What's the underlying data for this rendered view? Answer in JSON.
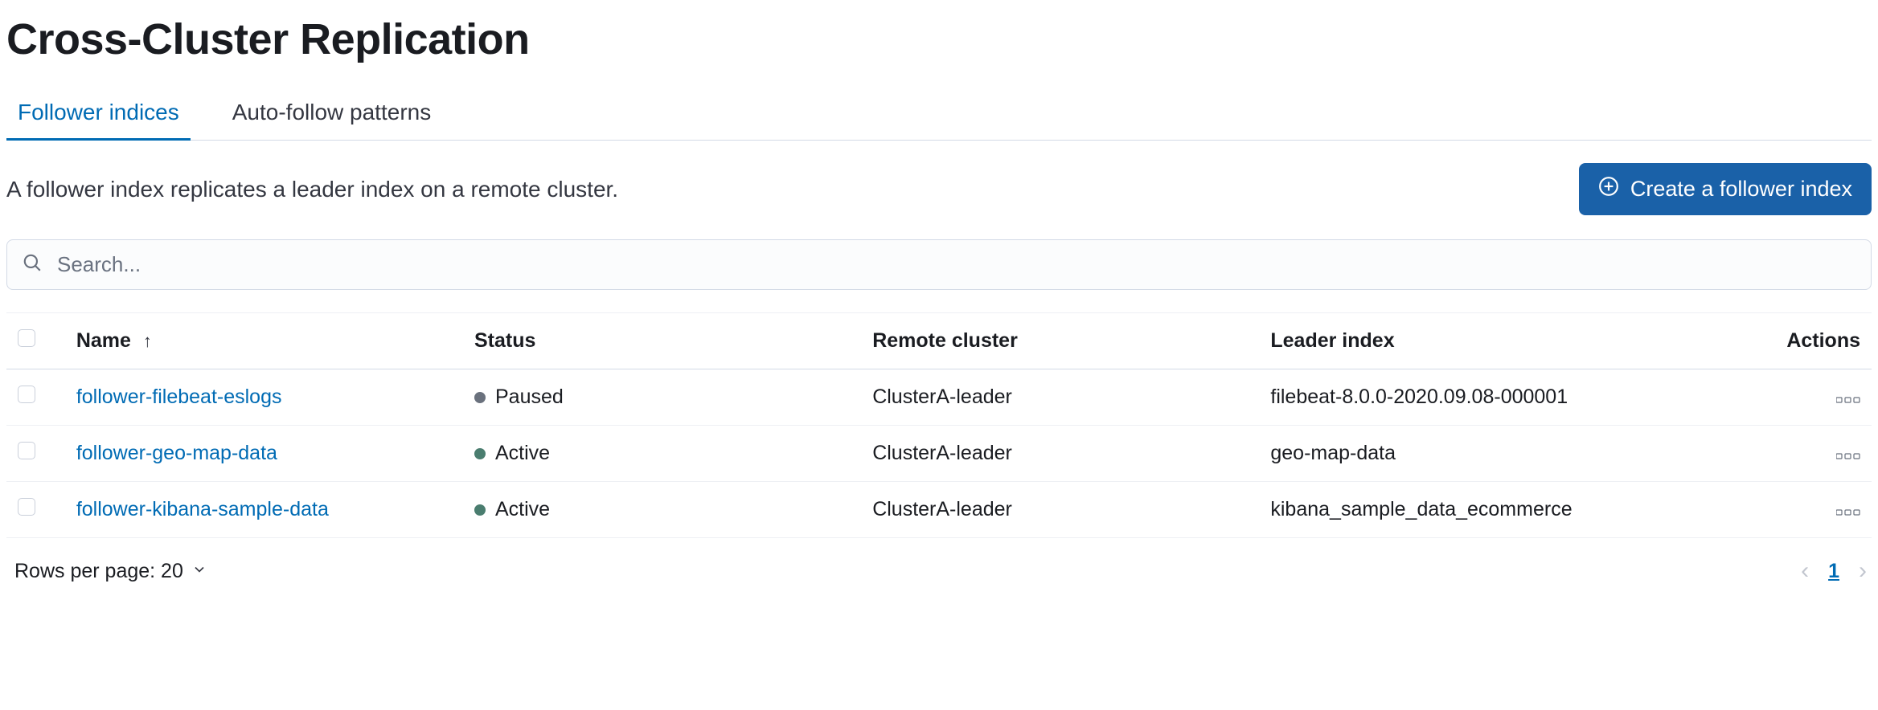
{
  "header": {
    "title": "Cross-Cluster Replication"
  },
  "tabs": [
    {
      "label": "Follower indices",
      "active": true
    },
    {
      "label": "Auto-follow patterns",
      "active": false
    }
  ],
  "description": "A follower index replicates a leader index on a remote cluster.",
  "create_button": "Create a follower index",
  "search": {
    "placeholder": "Search..."
  },
  "table": {
    "columns": {
      "name": "Name",
      "status": "Status",
      "remote": "Remote cluster",
      "leader": "Leader index",
      "actions": "Actions"
    },
    "rows": [
      {
        "name": "follower-filebeat-eslogs",
        "status": "Paused",
        "status_kind": "paused",
        "remote": "ClusterA-leader",
        "leader": "filebeat-8.0.0-2020.09.08-000001"
      },
      {
        "name": "follower-geo-map-data",
        "status": "Active",
        "status_kind": "active",
        "remote": "ClusterA-leader",
        "leader": "geo-map-data"
      },
      {
        "name": "follower-kibana-sample-data",
        "status": "Active",
        "status_kind": "active",
        "remote": "ClusterA-leader",
        "leader": "kibana_sample_data_ecommerce"
      }
    ]
  },
  "pagination": {
    "rows_per_page_label": "Rows per page: 20",
    "current_page": "1"
  }
}
